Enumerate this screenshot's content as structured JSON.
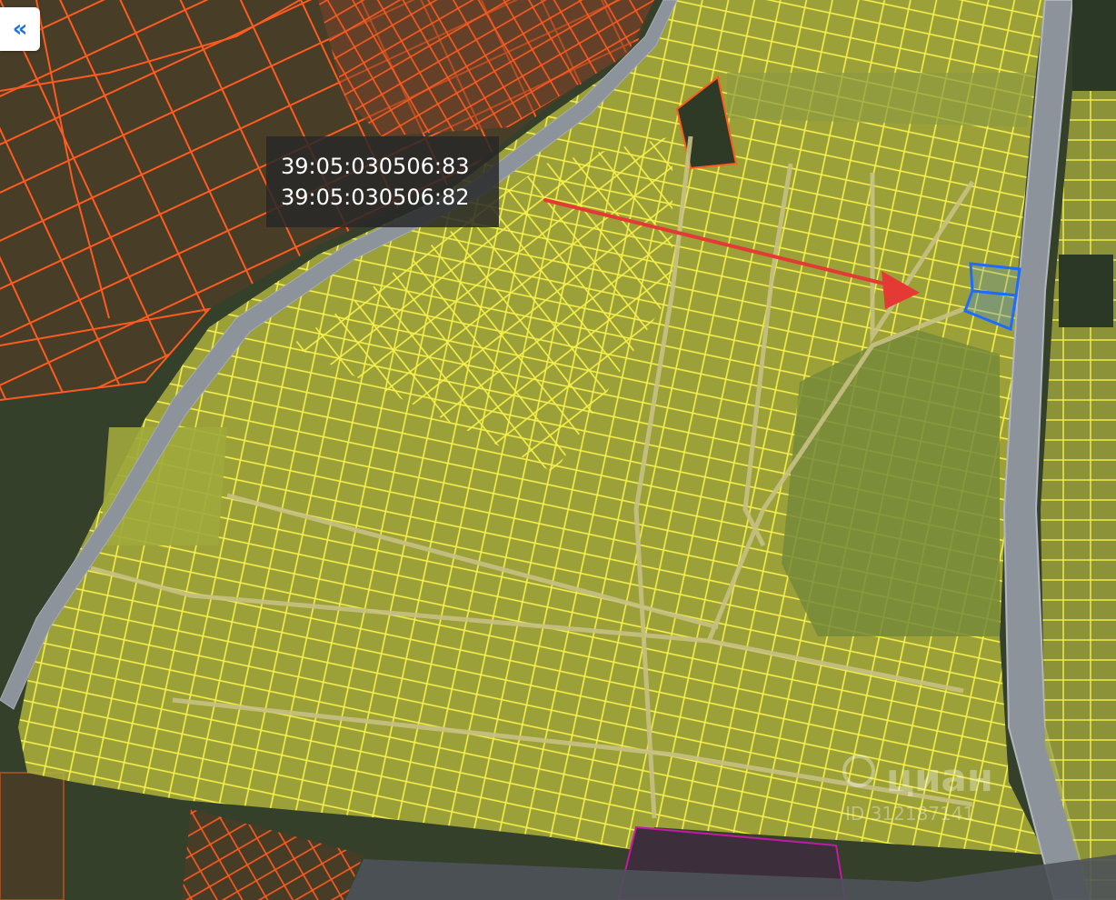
{
  "map": {
    "collapse_button": {
      "icon": "double-chevron-left-icon",
      "label": "«"
    },
    "parcel_label": {
      "lines": [
        "39:05:030506:83",
        "39:05:030506:82"
      ]
    },
    "colors": {
      "highlight_parcel": "#1e6bff",
      "neighbor_parcel": "#ff5722",
      "settlement_parcel": "#f2ef40",
      "arrow": "#e53935",
      "other_parcel": "#c21aa0",
      "road": "#8a8f96"
    }
  }
}
